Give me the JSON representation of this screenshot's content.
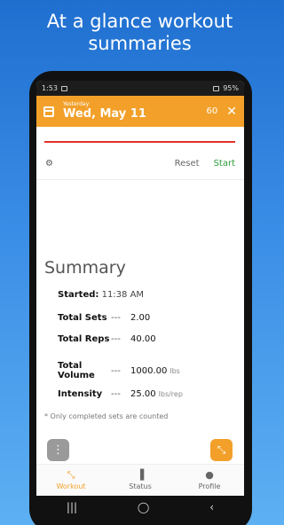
{
  "promo": {
    "title": "At a glance workout summaries"
  },
  "statusbar": {
    "time": "1:53",
    "battery": "95%"
  },
  "header": {
    "subtitle": "Yesterday",
    "date": "Wed, May 11",
    "count": "60",
    "close": "✕"
  },
  "toolbar": {
    "reset_label": "Reset",
    "start_label": "Start",
    "gear": "⚙"
  },
  "summary": {
    "title": "Summary",
    "started_label": "Started:",
    "started_value": "11:38 AM",
    "stats": [
      {
        "label": "Total Sets",
        "dash": "---",
        "value": "2.00",
        "unit": ""
      },
      {
        "label": "Total Reps",
        "dash": "---",
        "value": "40.00",
        "unit": ""
      },
      {
        "label": "Total Volume",
        "dash": "---",
        "value": "1000.00",
        "unit": "lbs"
      },
      {
        "label": "Intensity",
        "dash": "---",
        "value": "25.00",
        "unit": "lbs/rep"
      }
    ],
    "note": "* Only completed sets are counted"
  },
  "fabs": {
    "menu": "⋮",
    "expand": "⤡"
  },
  "nav": {
    "items": [
      {
        "label": "Workout",
        "icon": "expand-icon",
        "glyph": "⤡"
      },
      {
        "label": "Status",
        "icon": "bar-chart-icon",
        "glyph": "▐"
      },
      {
        "label": "Profile",
        "icon": "person-icon",
        "glyph": "●"
      }
    ]
  },
  "colors": {
    "accent": "#f2a02a",
    "start": "#2e9d3a",
    "line": "#e0302a"
  }
}
